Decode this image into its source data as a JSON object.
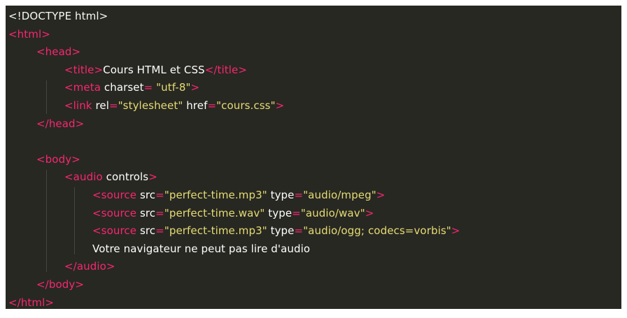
{
  "lines": [
    {
      "indent": 0,
      "tokens": [
        {
          "t": "doctype",
          "v": "<!DOCTYPE html>"
        }
      ]
    },
    {
      "indent": 0,
      "tokens": [
        {
          "t": "tag",
          "v": "<html>"
        }
      ]
    },
    {
      "indent": 1,
      "tokens": [
        {
          "t": "tag",
          "v": "<head>"
        }
      ]
    },
    {
      "indent": 2,
      "tokens": [
        {
          "t": "tag",
          "v": "<title>"
        },
        {
          "t": "txt",
          "v": "Cours HTML et CSS"
        },
        {
          "t": "tag",
          "v": "</title>"
        }
      ]
    },
    {
      "indent": 2,
      "tokens": [
        {
          "t": "tag",
          "v": "<meta "
        },
        {
          "t": "txt",
          "v": "charset"
        },
        {
          "t": "punct",
          "v": "= "
        },
        {
          "t": "str",
          "v": "\"utf-8\""
        },
        {
          "t": "tag",
          "v": ">"
        }
      ]
    },
    {
      "indent": 2,
      "tokens": [
        {
          "t": "tag",
          "v": "<link "
        },
        {
          "t": "txt",
          "v": "rel"
        },
        {
          "t": "punct",
          "v": "="
        },
        {
          "t": "str",
          "v": "\"stylesheet\""
        },
        {
          "t": "txt",
          "v": " href"
        },
        {
          "t": "punct",
          "v": "="
        },
        {
          "t": "str",
          "v": "\"cours.css\""
        },
        {
          "t": "tag",
          "v": ">"
        }
      ]
    },
    {
      "indent": 1,
      "tokens": [
        {
          "t": "tag",
          "v": "</head>"
        }
      ]
    },
    {
      "indent": 0,
      "tokens": []
    },
    {
      "indent": 1,
      "tokens": [
        {
          "t": "tag",
          "v": "<body>"
        }
      ]
    },
    {
      "indent": 2,
      "tokens": [
        {
          "t": "tag",
          "v": "<audio "
        },
        {
          "t": "txt",
          "v": "controls"
        },
        {
          "t": "tag",
          "v": ">"
        }
      ]
    },
    {
      "indent": 3,
      "tokens": [
        {
          "t": "tag",
          "v": "<source "
        },
        {
          "t": "txt",
          "v": "src"
        },
        {
          "t": "punct",
          "v": "="
        },
        {
          "t": "str",
          "v": "\"perfect-time.mp3\""
        },
        {
          "t": "txt",
          "v": " type"
        },
        {
          "t": "punct",
          "v": "="
        },
        {
          "t": "str",
          "v": "\"audio/mpeg\""
        },
        {
          "t": "tag",
          "v": ">"
        }
      ]
    },
    {
      "indent": 3,
      "tokens": [
        {
          "t": "tag",
          "v": "<source "
        },
        {
          "t": "txt",
          "v": "src"
        },
        {
          "t": "punct",
          "v": "="
        },
        {
          "t": "str",
          "v": "\"perfect-time.wav\""
        },
        {
          "t": "txt",
          "v": " type"
        },
        {
          "t": "punct",
          "v": "="
        },
        {
          "t": "str",
          "v": "\"audio/wav\""
        },
        {
          "t": "tag",
          "v": ">"
        }
      ]
    },
    {
      "indent": 3,
      "tokens": [
        {
          "t": "tag",
          "v": "<source "
        },
        {
          "t": "txt",
          "v": "src"
        },
        {
          "t": "punct",
          "v": "="
        },
        {
          "t": "str",
          "v": "\"perfect-time.mp3\""
        },
        {
          "t": "txt",
          "v": " type"
        },
        {
          "t": "punct",
          "v": "="
        },
        {
          "t": "str",
          "v": "\"audio/ogg; codecs=vorbis\""
        },
        {
          "t": "tag",
          "v": ">"
        }
      ]
    },
    {
      "indent": 3,
      "tokens": [
        {
          "t": "txt",
          "v": "Votre navigateur ne peut pas lire d'audio"
        }
      ]
    },
    {
      "indent": 2,
      "tokens": [
        {
          "t": "tag",
          "v": "</audio>"
        }
      ]
    },
    {
      "indent": 1,
      "tokens": [
        {
          "t": "tag",
          "v": "</body>"
        }
      ]
    },
    {
      "indent": 0,
      "tokens": [
        {
          "t": "tag",
          "v": "</html>"
        }
      ]
    }
  ],
  "colors": {
    "background": "#272822",
    "tag": "#f92672",
    "attribute": "#ffffff",
    "string": "#e6db74",
    "text": "#ffffff"
  }
}
